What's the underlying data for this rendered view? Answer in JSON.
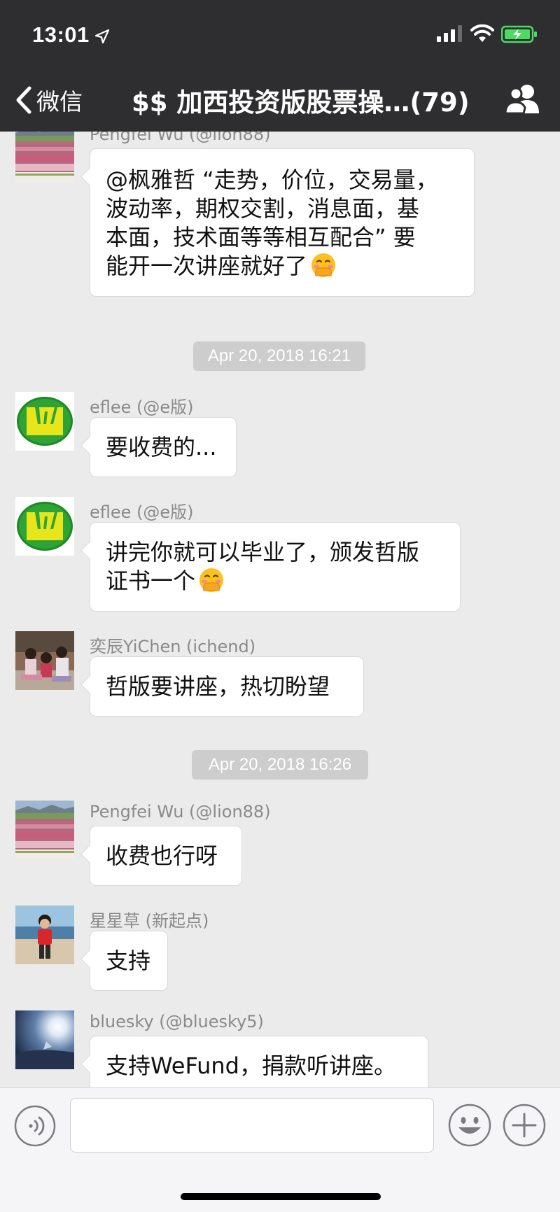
{
  "status_bar": {
    "time": "13:01"
  },
  "nav": {
    "back_label": "微信",
    "title": "$$ 加西投资版股票操…(79)"
  },
  "messages": [
    {
      "sender": "Pengfei Wu (@lion88)",
      "text": "@枫雅哲 “走势，价位，交易量，波动率，期权交割，消息面，基本面，技术面等等相互配合” 要能开一次讲座就好了",
      "emoji": "face-with-hand-over-mouth"
    },
    {
      "sender": "eflee (@e版)",
      "text": "要收费的..."
    },
    {
      "sender": "eflee (@e版)",
      "text": "讲完你就可以毕业了，颁发哲版证书一个",
      "emoji": "face-with-hand-over-mouth"
    },
    {
      "sender": "奕辰YiChen (ichend)",
      "text": "哲版要讲座，热切盼望"
    },
    {
      "sender": "Pengfei Wu (@lion88)",
      "text": "收费也行呀"
    },
    {
      "sender": "星星草 (新起点)",
      "text": "支持"
    },
    {
      "sender": "bluesky (@bluesky5)",
      "text": "支持WeFund，捐款听讲座。"
    }
  ],
  "timestamps": [
    "Apr 20, 2018 16:21",
    "Apr 20, 2018 16:26"
  ],
  "line_parts": {
    "m0": [
      "@枫雅哲 “走势，价位，交易量，",
      "波动率，期权交割，消息面，基",
      "本面，技术面等等相互配合” 要",
      "能开一次讲座就好了"
    ],
    "m2": [
      "讲完你就可以毕业了，颁发哲版",
      "证书一个"
    ]
  },
  "icons": {
    "voice": "voice-input-icon",
    "emoji": "emoji-icon",
    "plus": "plus-icon",
    "group": "group-members-icon",
    "back": "chevron-left-icon"
  },
  "colors": {
    "header_bg": "#2e2e30",
    "chat_bg": "#ebebeb",
    "battery_green": "#4cd964"
  }
}
